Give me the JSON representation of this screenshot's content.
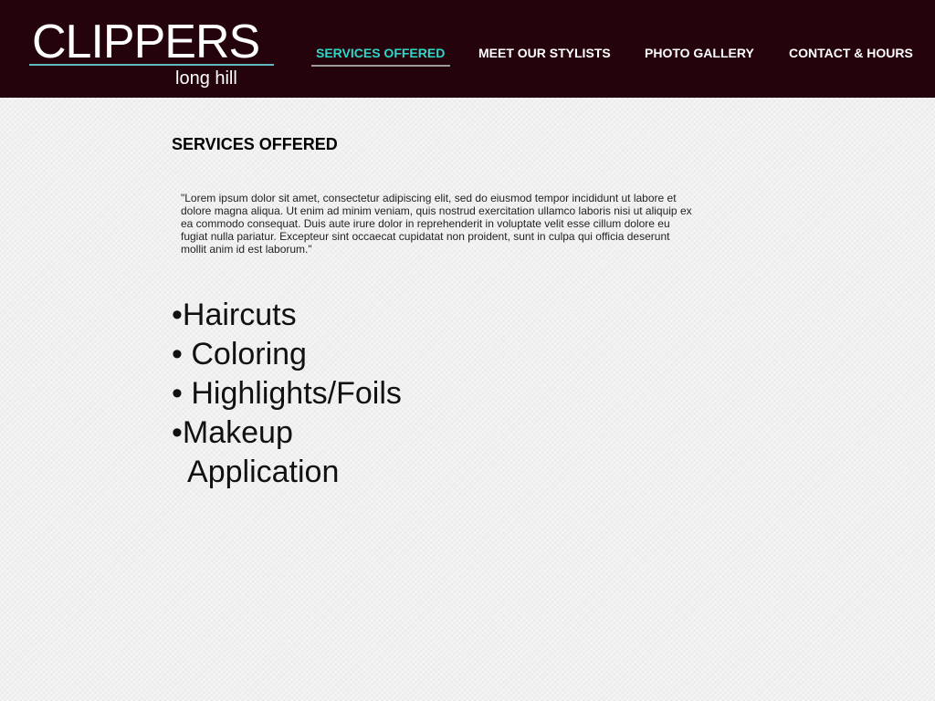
{
  "brand": {
    "name": "CLIPPERS",
    "subname": "long hill",
    "accent_color": "#5fb8c2"
  },
  "nav": {
    "items": [
      {
        "label": "SERVICES OFFERED",
        "active": true
      },
      {
        "label": "MEET OUR STYLISTS",
        "active": false
      },
      {
        "label": "PHOTO GALLERY",
        "active": false
      },
      {
        "label": "CONTACT & HOURS",
        "active": false
      }
    ],
    "active_color": "#2ed8c8",
    "header_color": "#25030c"
  },
  "main": {
    "title": "SERVICES OFFERED",
    "intro": "\"Lorem ipsum dolor sit amet, consectetur adipiscing elit, sed do eiusmod tempor incididunt ut labore et dolore magna aliqua. Ut enim ad minim veniam, quis nostrud exercitation ullamco laboris nisi ut aliquip ex ea commodo consequat. Duis aute irure dolor in reprehenderit in voluptate velit esse cillum dolore eu fugiat nulla pariatur. Excepteur sint occaecat cupidatat non proident, sunt in culpa qui officia deserunt mollit anim id est laborum.\"",
    "services": [
      "•Haircuts",
      "• Coloring",
      "• Highlights/Foils",
      "•Makeup",
      "  Application"
    ]
  }
}
